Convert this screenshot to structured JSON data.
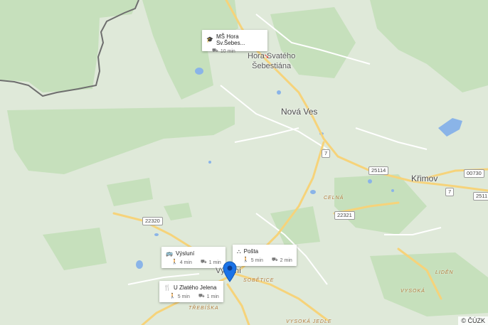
{
  "map": {
    "attribution": "© ČÚZK",
    "colors": {
      "land": "#dfe9d9",
      "forest": "#c6e0bc",
      "water": "#8ab4e8",
      "road_major": "#f6d37a",
      "road_minor": "#ffffff",
      "border": "#6e6e6e",
      "pin": "#1a73e8"
    },
    "places": {
      "hora": "Hora Svatého\nŠebestiána",
      "nova_ves": "Nová Ves",
      "krimov": "Křimov",
      "vysluni_town": "Výsluní"
    },
    "localities": {
      "celna": "CELNÁ",
      "sobetice": "SOBĚTICE",
      "liden": "LIDĚN",
      "vysoka": "VYSOKÁ",
      "trebiska": "TŘEBÍŠKA",
      "vysoka_jedle": "VYSOKÁ JEDLE"
    },
    "road_shields": {
      "r7a": "7",
      "r25114": "25114",
      "r7b": "7",
      "r00730": "00730",
      "r2511": "2511",
      "r22321": "22321",
      "r22320": "22320"
    },
    "cards": [
      {
        "id": "ms",
        "icon": "school-icon",
        "title": "MŠ Hora Sv.Šebes...",
        "walk": "",
        "drive": "10 min"
      },
      {
        "id": "vysluni",
        "icon": "bus-icon",
        "title": "Výsluní",
        "walk": "4 min",
        "drive": "1 min"
      },
      {
        "id": "posta",
        "icon": "post-icon",
        "title": "Pošta",
        "walk": "5 min",
        "drive": "2 min"
      },
      {
        "id": "jelen",
        "icon": "restaurant-icon",
        "title": "U Zlatého Jelena",
        "walk": "5 min",
        "drive": "1 min"
      }
    ]
  }
}
